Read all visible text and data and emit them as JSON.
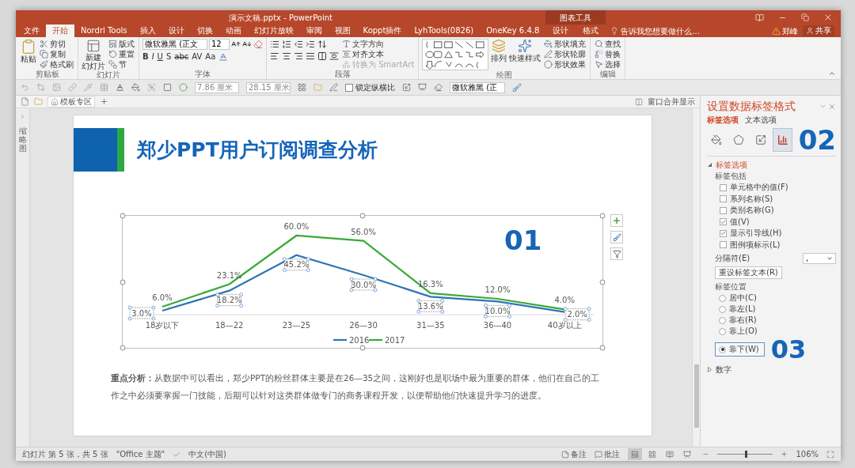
{
  "window": {
    "title": "演示文稿.pptx - PowerPoint",
    "context_group": "图表工具"
  },
  "menu_tabs": [
    {
      "label": "文件",
      "selected": false
    },
    {
      "label": "开始",
      "selected": true
    },
    {
      "label": "Nordri Tools",
      "selected": false
    },
    {
      "label": "插入",
      "selected": false
    },
    {
      "label": "设计",
      "selected": false
    },
    {
      "label": "切换",
      "selected": false
    },
    {
      "label": "动画",
      "selected": false
    },
    {
      "label": "幻灯片放映",
      "selected": false
    },
    {
      "label": "审阅",
      "selected": false
    },
    {
      "label": "视图",
      "selected": false
    },
    {
      "label": "Koppt插件",
      "selected": false
    },
    {
      "label": "LyhTools(0826)",
      "selected": false
    },
    {
      "label": "OneKey 6.4.8",
      "selected": false
    }
  ],
  "context_tabs": [
    {
      "label": "设计",
      "selected": false
    },
    {
      "label": "格式",
      "selected": false
    }
  ],
  "tell_me": {
    "placeholder": "告诉我您想要做什么..."
  },
  "user": "郑峰",
  "share": "共享",
  "ribbon": {
    "clipboard": {
      "label": "剪贴板",
      "buttons": [
        "粘贴",
        "剪切",
        "复制",
        "格式刷"
      ]
    },
    "slides": {
      "label": "幻灯片",
      "new_slide": [
        "新建",
        "幻灯片"
      ],
      "buttons": [
        "版式",
        "重置",
        "节"
      ]
    },
    "font": {
      "label": "字体",
      "font": "微软雅黑 (正文",
      "size": "12",
      "format_buttons": [
        "B",
        "I",
        "U",
        "S",
        "abc",
        "AV",
        "Aa"
      ]
    },
    "paragraph": {
      "label": "段落",
      "buttons": [
        {
          "label": "文字方向",
          "disabled": false
        },
        {
          "label": "对齐文本",
          "disabled": false
        },
        {
          "label": "转换为 SmartArt",
          "disabled": true
        }
      ]
    },
    "drawing": {
      "label": "绘图",
      "large_buttons": [
        "排列",
        "快速样式"
      ],
      "buttons": [
        "形状填充",
        "形状轮廓",
        "形状效果"
      ]
    },
    "editing": {
      "label": "编辑",
      "buttons": [
        "查找",
        "替换",
        "选择"
      ]
    }
  },
  "format_bar": {
    "size_fields": [
      "7.86 厘米",
      "28.15 厘米"
    ],
    "lock_ratio": {
      "label": "锁定纵横比",
      "checked": false
    },
    "font": "微软雅黑 (正"
  },
  "doc_tabs": {
    "tabs": [
      {
        "label": "模板专区"
      }
    ],
    "merge": "窗口合并显示"
  },
  "thumbnail_pane": {
    "label": "缩略图"
  },
  "slide": {
    "title": "郑少PPT用户订阅调查分析",
    "chart": {
      "annotation": "01",
      "chart_data": {
        "type": "line",
        "categories": [
          "18岁以下",
          "18—22",
          "23—25",
          "26—30",
          "31—35",
          "36—40",
          "40岁以上"
        ],
        "series": [
          {
            "name": "2016",
            "color": "#2e75b6",
            "values": [
              3.0,
              18.2,
              45.2,
              30.0,
              13.6,
              10.0,
              2.0
            ],
            "value_labels": [
              "3.0%",
              "18.2%",
              "45.2%",
              "30.0%",
              "13.6%",
              "10.0%",
              "2.0%"
            ]
          },
          {
            "name": "2017",
            "color": "#3aaa35",
            "values": [
              6.0,
              23.1,
              60.0,
              56.0,
              16.3,
              12.0,
              4.0
            ],
            "value_labels": [
              "6.0%",
              "23.1%",
              "60.0%",
              "56.0%",
              "16.3%",
              "12.0%",
              "4.0%"
            ]
          }
        ],
        "legend": "bottom"
      }
    },
    "paragraph": "**重点分析：**从数据中可以看出，郑少PPT的粉丝群体主要是在26—35之间，这刚好也是职场中最为重要的群体，他们在自己的工作之中必须要掌握一门技能，后期可以针对这类群体做专门的商务课程开发，以便帮助他们快速提升学习的进度。"
  },
  "format_pane": {
    "title": "设置数据标签格式",
    "tabs": [
      {
        "label": "标签选项",
        "selected": true
      },
      {
        "label": "文本选项",
        "selected": false
      }
    ],
    "icon_tabs": [
      {
        "selected": false
      },
      {
        "selected": false
      },
      {
        "selected": false
      },
      {
        "selected": true
      }
    ],
    "icon_tabs_annotation": "02",
    "label_options": {
      "label": "标签选项",
      "expanded": true,
      "include_heading": "标签包括",
      "checkboxes": [
        {
          "label": "单元格中的值(F)",
          "checked": false
        },
        {
          "label": "系列名称(S)",
          "checked": false
        },
        {
          "label": "类别名称(G)",
          "checked": false
        },
        {
          "label": "值(V)",
          "checked": true
        },
        {
          "label": "显示引导线(H)",
          "checked": true
        },
        {
          "label": "图例项标示(L)",
          "checked": false
        }
      ],
      "separator": {
        "label": "分隔符(E)",
        "value": ","
      },
      "reset_button": "重设标签文本(R)",
      "position_heading": "标签位置",
      "positions": [
        {
          "label": "居中(C)",
          "selected": false
        },
        {
          "label": "靠左(L)",
          "selected": false
        },
        {
          "label": "靠右(R)",
          "selected": false
        },
        {
          "label": "靠上(O)",
          "selected": false
        },
        {
          "label": "靠下(W)",
          "selected": true
        }
      ],
      "positions_annotation": "03"
    },
    "number_section": {
      "label": "数字",
      "expanded": false
    }
  },
  "status_bar": {
    "slide": "幻灯片 第 5 张，共 5 张",
    "theme": "\"Office 主题\"",
    "language": "中文(中国)",
    "notes": "备注",
    "comments": "批注",
    "views": [
      {
        "selected": true
      },
      {
        "selected": false
      },
      {
        "selected": false
      },
      {
        "selected": false
      }
    ],
    "zoom": {
      "level": 0.5
    },
    "zoom_text": "106%"
  }
}
